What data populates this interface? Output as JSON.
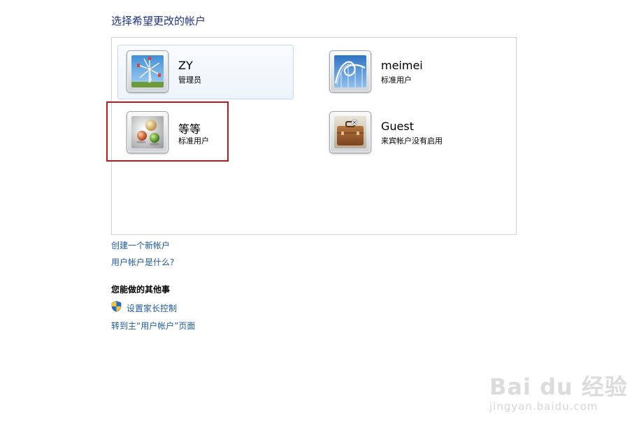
{
  "page": {
    "title": "选择希望更改的帐户"
  },
  "accounts": [
    {
      "name": "ZY",
      "role": "管理员",
      "picture": "windmill-icon",
      "selected": true
    },
    {
      "name": "meimei",
      "role": "标准用户",
      "picture": "rollercoaster-icon",
      "selected": false
    },
    {
      "name": "等等",
      "role": "标准用户",
      "picture": "marbles-icon",
      "selected": false
    },
    {
      "name": "Guest",
      "role": "来宾帐户没有启用",
      "picture": "suitcase-icon",
      "selected": false
    }
  ],
  "links": {
    "create_account": "创建一个新帐户",
    "what_is_account": "用户帐户是什么?"
  },
  "other_tasks": {
    "heading": "您能做的其他事",
    "parental_controls": "设置家长控制",
    "goto_main": "转到主“用户帐户”页面"
  },
  "annotation": {
    "highlight_color": "#c4161c"
  },
  "watermark": {
    "logo": "Bai du 经验",
    "url": "jingyan.baidu.com"
  },
  "colors": {
    "title": "#1e3287",
    "link": "#1e5aa8"
  }
}
